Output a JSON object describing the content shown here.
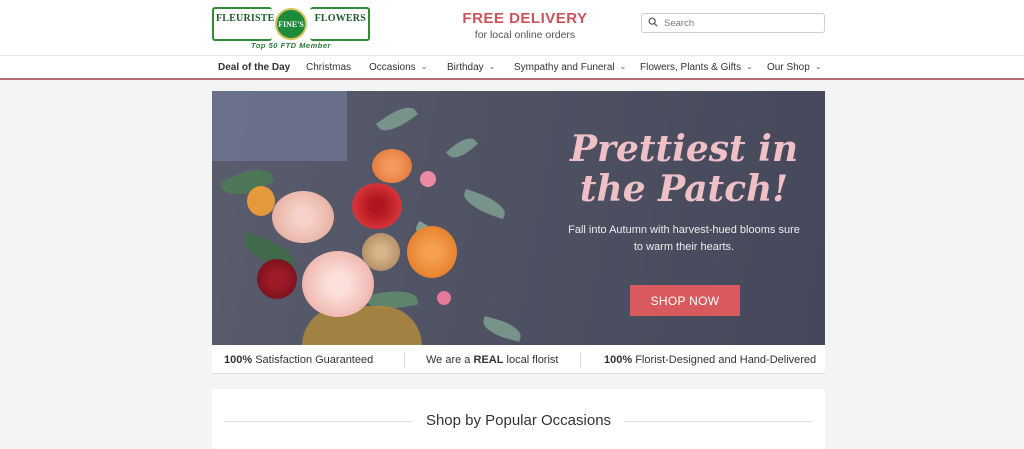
{
  "header": {
    "logo": {
      "left_text": "FLEURISTE",
      "center_text": "FINE'S",
      "right_text": "FLOWERS",
      "tagline": "Top 50 FTD Member"
    },
    "delivery_title": "FREE DELIVERY",
    "delivery_subtitle": "for local online orders",
    "search_placeholder": "Search"
  },
  "nav": [
    {
      "label": "Deal of the Day",
      "active": true,
      "dropdown": false
    },
    {
      "label": "Christmas",
      "dropdown": false
    },
    {
      "label": "Occasions",
      "dropdown": true
    },
    {
      "label": "Birthday",
      "dropdown": true
    },
    {
      "label": "Sympathy and Funeral",
      "dropdown": true
    },
    {
      "label": "Flowers, Plants & Gifts",
      "dropdown": true
    },
    {
      "label": "Our Shop",
      "dropdown": true
    }
  ],
  "hero": {
    "headline": "Prettiest in the Patch!",
    "subcopy": "Fall into Autumn with harvest-hued blooms sure to warm their hearts.",
    "button": "SHOP NOW"
  },
  "benefits": [
    {
      "bold": "100%",
      "text": " Satisfaction Guaranteed"
    },
    {
      "pre": "We are a ",
      "bold": "REAL",
      "text": " local florist"
    },
    {
      "bold": "100%",
      "text": " Florist-Designed and Hand-Delivered"
    }
  ],
  "section_title": "Shop by Popular Occasions",
  "colors": {
    "accent": "#c9545a",
    "button": "#d85a5e",
    "nav_border": "#b86a78",
    "hero_bg": "#4a4d5e"
  }
}
